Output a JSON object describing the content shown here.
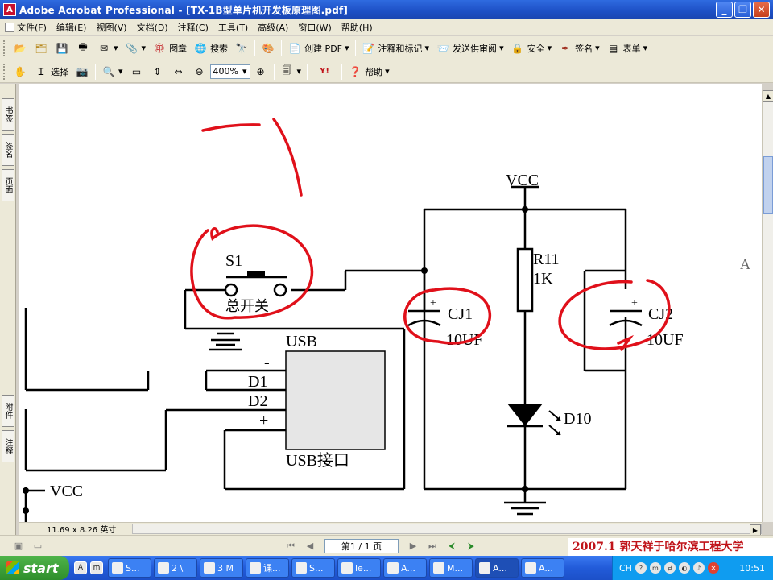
{
  "window": {
    "title": "Adobe Acrobat Professional - [TX-1B型单片机开发板原理图.pdf]",
    "app_icon_text": "A"
  },
  "menubar": {
    "items": [
      "文件(F)",
      "编辑(E)",
      "视图(V)",
      "文档(D)",
      "注释(C)",
      "工具(T)",
      "高级(A)",
      "窗口(W)",
      "帮助(H)"
    ]
  },
  "toolbar1": {
    "stamp_label": "图章",
    "search_label": "搜索",
    "create_pdf_label": "创建 PDF",
    "comment_label": "注释和标记",
    "review_label": "发送供审阅",
    "security_label": "安全",
    "sign_label": "签名",
    "forms_label": "表单"
  },
  "toolbar2": {
    "select_label": "选择",
    "zoom_value": "400%",
    "help_label": "帮助"
  },
  "left_tabs": [
    "书签",
    "签名",
    "页面",
    "附件",
    "注释"
  ],
  "right_panel_letter": "A",
  "schematic": {
    "labels": {
      "vcc_top": "VCC",
      "r11": "R11",
      "r11_value": "1K",
      "s1": "S1",
      "switch_cn": "总开关",
      "cj1": "CJ1",
      "cj1_value": "10UF",
      "cj2": "CJ2",
      "cj2_value": "10UF",
      "plus1": "+",
      "plus2": "+",
      "usb": "USB",
      "usb_port": "USB接口",
      "minus_pin": "-",
      "d1": "D1",
      "d2": "D2",
      "plus_pin": "+",
      "d10": "D10",
      "vcc_left": "VCC"
    },
    "annotation_color": "#e0101a"
  },
  "status": {
    "page_size": "11.69 x 8.26 英寸",
    "page_indicator": "第1 / 1 页"
  },
  "caption": "2007.1  郭天祥于哈尔滨工程大学",
  "taskbar": {
    "start_label": "start",
    "tasks": [
      "S...",
      "2 \\",
      "3 M",
      "课...",
      "S...",
      "le...",
      "A...",
      "M...",
      "A...",
      "A..."
    ],
    "tray_lang": "CH",
    "clock": "10:51"
  }
}
